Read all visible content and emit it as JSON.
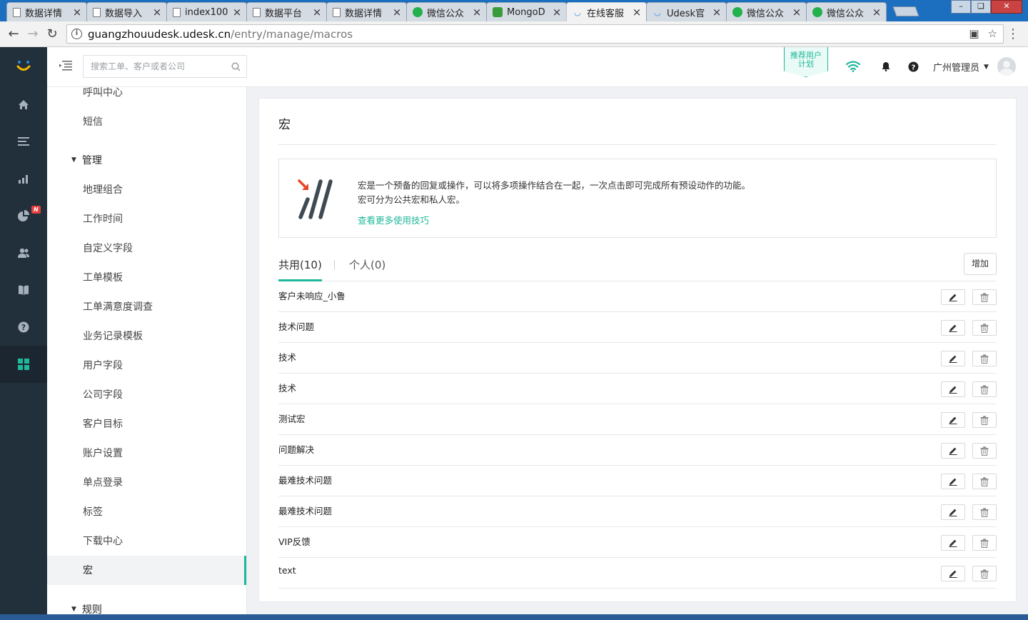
{
  "browser": {
    "tabs": [
      {
        "title": "数据详情",
        "icon": "doc"
      },
      {
        "title": "数据导入",
        "icon": "doc"
      },
      {
        "title": "index100",
        "icon": "doc"
      },
      {
        "title": "数据平台",
        "icon": "doc"
      },
      {
        "title": "数据详情",
        "icon": "doc"
      },
      {
        "title": "微信公众",
        "icon": "wechat"
      },
      {
        "title": "MongoD",
        "icon": "mongo"
      },
      {
        "title": "在线客服",
        "icon": "udesk"
      },
      {
        "title": "Udesk官",
        "icon": "udesk"
      },
      {
        "title": "微信公众",
        "icon": "wechat"
      },
      {
        "title": "微信公众",
        "icon": "wechat"
      }
    ],
    "active_tab_index": 7,
    "url_host": "guangzhouudesk.udesk.cn",
    "url_path": "/entry/manage/macros"
  },
  "topbar": {
    "search_placeholder": "搜索工单、客户或者公司",
    "recommend_line1": "推荐用户",
    "recommend_line2": "计划",
    "user_name": "广州管理员"
  },
  "rail": {
    "items": [
      "home-icon",
      "list-icon",
      "bar-chart-icon",
      "pie-chart-icon",
      "users-icon",
      "book-icon",
      "help-icon",
      "apps-icon"
    ],
    "badge": "N",
    "active": "apps-icon"
  },
  "subnav": {
    "items_top": [
      "呼叫中心",
      "短信"
    ],
    "group_manage": "管理",
    "items_manage": [
      "地理组合",
      "工作时间",
      "自定义字段",
      "工单模板",
      "工单满意度调查",
      "业务记录模板",
      "用户字段",
      "公司字段",
      "客户目标",
      "账户设置",
      "单点登录",
      "标签",
      "下载中心",
      "宏"
    ],
    "active_item": "宏",
    "group_rules": "规则"
  },
  "main": {
    "title": "宏",
    "intro_line1": "宏是一个预备的回复或操作，可以将多项操作结合在一起，一次点击即可完成所有预设动作的功能。",
    "intro_line2": "宏可分为公共宏和私人宏。",
    "intro_link": "查看更多使用技巧",
    "tab_public": "共用(10)",
    "tab_private": "个人(0)",
    "add_label": "增加",
    "macros": [
      "客户未响应_小鲁",
      "技术问题",
      "技术",
      "技术",
      "测试宏",
      "问题解决",
      "最难技术问题",
      "最难技术问题",
      "VIP反馈",
      "text"
    ]
  },
  "colors": {
    "accent": "#1fb89a",
    "rail_bg": "#22303c",
    "badge": "#e8403f"
  }
}
